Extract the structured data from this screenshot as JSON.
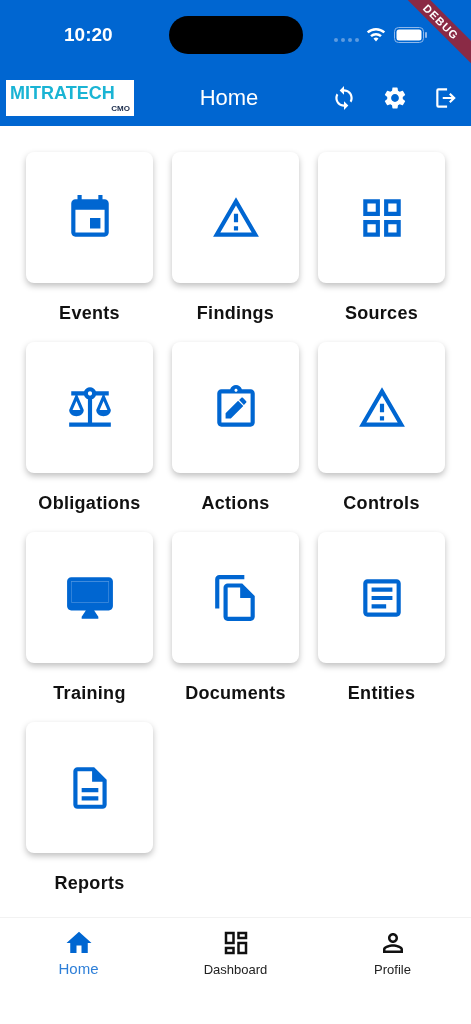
{
  "status_bar": {
    "time": "10:20"
  },
  "debug_banner": "DEBUG",
  "app_bar": {
    "logo": {
      "name": "MITRATECH",
      "sub": "CMO"
    },
    "title": "Home",
    "actions": [
      {
        "kind": "sync"
      },
      {
        "kind": "settings"
      },
      {
        "kind": "logout"
      }
    ]
  },
  "tiles": [
    {
      "label": "Events",
      "kind": "calendar"
    },
    {
      "label": "Findings",
      "kind": "warning"
    },
    {
      "label": "Sources",
      "kind": "grid"
    },
    {
      "label": "Obligations",
      "kind": "scale"
    },
    {
      "label": "Actions",
      "kind": "clipboard"
    },
    {
      "label": "Controls",
      "kind": "warning"
    },
    {
      "label": "Training",
      "kind": "monitor"
    },
    {
      "label": "Documents",
      "kind": "copy"
    },
    {
      "label": "Entities",
      "kind": "article"
    },
    {
      "label": "Reports",
      "kind": "document"
    }
  ],
  "bottom_nav": [
    {
      "label": "Home",
      "kind": "home",
      "selected": true
    },
    {
      "label": "Dashboard",
      "kind": "dashboard",
      "selected": false
    },
    {
      "label": "Profile",
      "kind": "profile",
      "selected": false
    }
  ]
}
